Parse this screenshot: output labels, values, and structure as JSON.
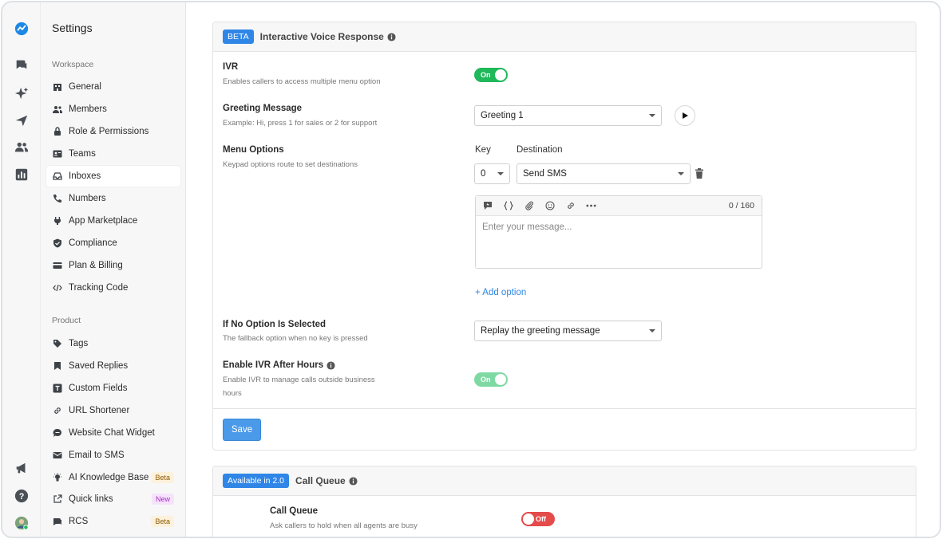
{
  "colors": {
    "accent": "#2f86e6",
    "toggle_on": "#1fb85a",
    "toggle_off": "#e44b4b"
  },
  "sidebar": {
    "title": "Settings",
    "workspace_label": "Workspace",
    "workspace_items": [
      {
        "label": "General",
        "icon": "building-icon"
      },
      {
        "label": "Members",
        "icon": "users-icon"
      },
      {
        "label": "Role & Permissions",
        "icon": "lock-icon"
      },
      {
        "label": "Teams",
        "icon": "id-card-icon"
      },
      {
        "label": "Inboxes",
        "icon": "inbox-icon",
        "active": true
      },
      {
        "label": "Numbers",
        "icon": "phone-icon"
      },
      {
        "label": "App Marketplace",
        "icon": "plug-icon"
      },
      {
        "label": "Compliance",
        "icon": "shield-icon"
      },
      {
        "label": "Plan & Billing",
        "icon": "credit-card-icon"
      },
      {
        "label": "Tracking Code",
        "icon": "code-icon"
      }
    ],
    "product_label": "Product",
    "product_items": [
      {
        "label": "Tags",
        "icon": "tag-icon"
      },
      {
        "label": "Saved Replies",
        "icon": "bookmark-icon"
      },
      {
        "label": "Custom Fields",
        "icon": "text-field-icon"
      },
      {
        "label": "URL Shortener",
        "icon": "link-icon"
      },
      {
        "label": "Website Chat Widget",
        "icon": "chat-bubble-icon"
      },
      {
        "label": "Email to SMS",
        "icon": "mail-icon"
      },
      {
        "label": "AI Knowledge Base",
        "icon": "lightbulb-icon",
        "badge": "Beta"
      },
      {
        "label": "Quick links",
        "icon": "external-link-icon",
        "badge": "New"
      },
      {
        "label": "RCS",
        "icon": "rcs-icon",
        "badge": "Beta"
      }
    ]
  },
  "ivr_card": {
    "badge": "BETA",
    "title": "Interactive Voice Response",
    "ivr": {
      "label": "IVR",
      "desc": "Enables callers to access multiple menu option",
      "toggle": "On"
    },
    "greeting": {
      "label": "Greeting Message",
      "desc": "Example: Hi, press 1 for sales or 2 for support",
      "value": "Greeting 1"
    },
    "menu": {
      "label": "Menu Options",
      "desc": "Keypad options route to set destinations",
      "key_header": "Key",
      "destination_header": "Destination",
      "key_value": "0",
      "destination_value": "Send SMS",
      "counter": "0 / 160",
      "message_placeholder": "Enter your message...",
      "add_option": "+ Add option"
    },
    "no_option": {
      "label": "If No Option Is Selected",
      "desc": "The fallback option when no key is pressed",
      "value": "Replay the greeting message"
    },
    "after_hours": {
      "label": "Enable IVR After Hours",
      "desc_line1": "Enable IVR to manage calls outside business",
      "desc_line2": "hours",
      "toggle": "On"
    },
    "save_label": "Save"
  },
  "queue_card": {
    "badge": "Available in 2.0",
    "title": "Call Queue",
    "row": {
      "label": "Call Queue",
      "desc": "Ask callers to hold when all agents are busy",
      "toggle": "Off"
    }
  }
}
